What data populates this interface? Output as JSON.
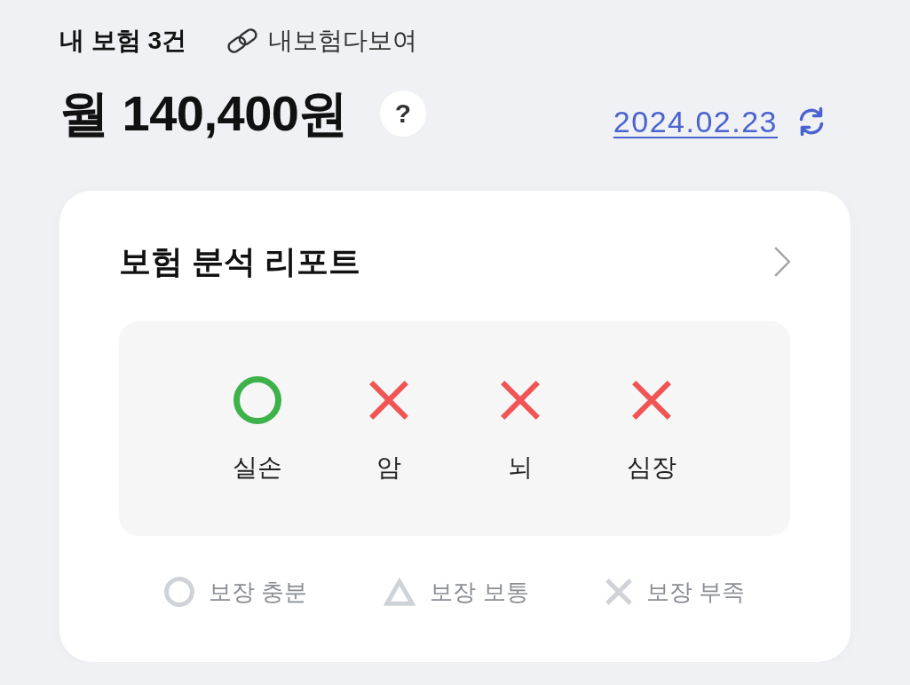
{
  "header": {
    "title": "내 보험 3건",
    "link": "내보험다보여"
  },
  "premium": {
    "amount": "월 140,400원",
    "help_button": "?"
  },
  "updated": {
    "date": "2024.02.23"
  },
  "report": {
    "title": "보험 분석 리포트",
    "items": [
      {
        "label": "실손",
        "kind": "sufficient"
      },
      {
        "label": "암",
        "kind": "insufficient"
      },
      {
        "label": "뇌",
        "kind": "insufficient"
      },
      {
        "label": "심장",
        "kind": "insufficient"
      }
    ],
    "legend": [
      {
        "label": "보장 충분",
        "kind": "sufficient"
      },
      {
        "label": "보장 보통",
        "kind": "normal"
      },
      {
        "label": "보장 부족",
        "kind": "insufficient"
      }
    ]
  }
}
